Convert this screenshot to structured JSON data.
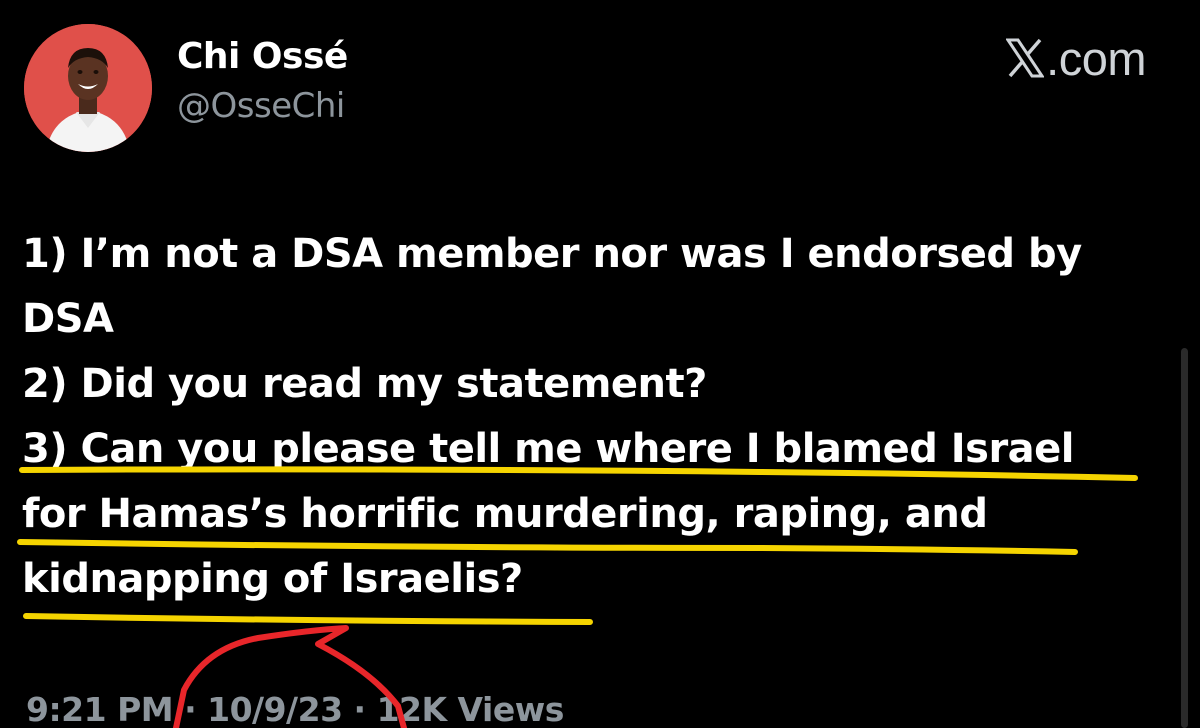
{
  "author": {
    "display_name": "Chi Ossé",
    "handle": "@OsseChi",
    "avatar_icon": "profile-photo"
  },
  "brand": {
    "label": ".com",
    "icon": "x-logo-icon"
  },
  "tweet": {
    "lines": [
      "1) I’m not a DSA member nor was I endorsed by",
      "DSA",
      "2) Did you read my statement?",
      "3) Can you please tell me where I blamed Israel",
      "for Hamas’s horrific murdering, raping, and",
      "kidnapping of Israelis?"
    ]
  },
  "meta": {
    "time": "9:21 PM",
    "separator": " · ",
    "date": "10/9/23",
    "views_count": "12K",
    "views_label": " Views"
  },
  "colors": {
    "background": "#000000",
    "text": "#ffffff",
    "secondary_text": "#8d959c",
    "avatar_bg": "#e0504a",
    "highlight_underline": "#f5d400",
    "annotation_circle": "#e8262a"
  }
}
